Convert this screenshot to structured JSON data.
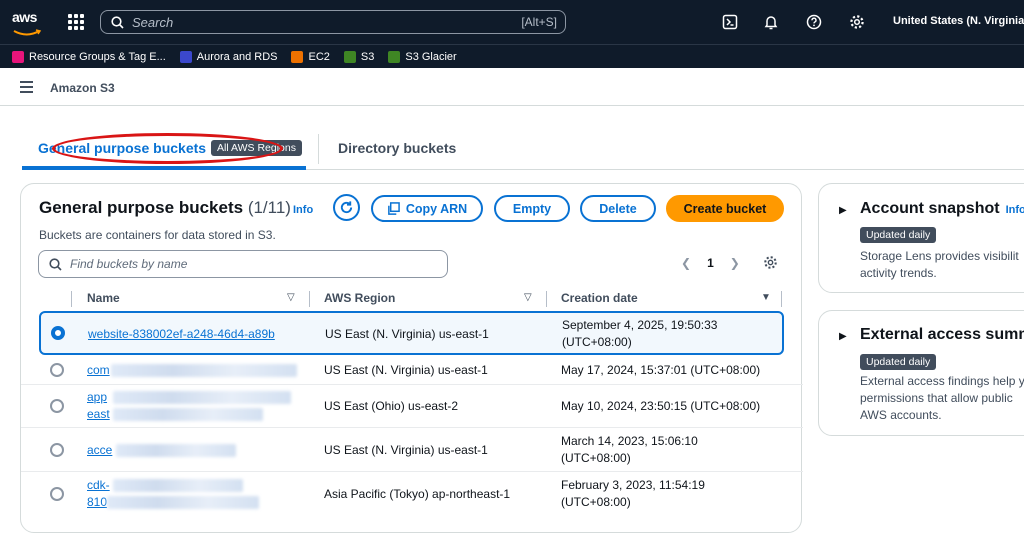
{
  "topbar": {
    "logo_text": "aws",
    "search_placeholder": "Search",
    "search_shortcut": "[Alt+S]",
    "region": "United States (N. Virginia)"
  },
  "favorites": [
    {
      "label": "Resource Groups & Tag E...",
      "color": "#e7157b"
    },
    {
      "label": "Aurora and RDS",
      "color": "#3b48cc"
    },
    {
      "label": "EC2",
      "color": "#ed7100"
    },
    {
      "label": "S3",
      "color": "#3f8624"
    },
    {
      "label": "S3 Glacier",
      "color": "#3f8624"
    }
  ],
  "service": {
    "title": "Amazon S3"
  },
  "tabs": {
    "general": "General purpose buckets",
    "general_badge": "All AWS Regions",
    "directory": "Directory buckets"
  },
  "panel": {
    "title": "General purpose buckets",
    "count": "(1/11)",
    "info": "Info",
    "description": "Buckets are containers for data stored in S3.",
    "copy_arn": "Copy ARN",
    "empty": "Empty",
    "delete": "Delete",
    "create": "Create bucket",
    "find_placeholder": "Find buckets by name",
    "page": "1",
    "col_name": "Name",
    "col_region": "AWS Region",
    "col_date": "Creation date"
  },
  "rows": [
    {
      "name": "website-838002ef-a248-46d4-a89b",
      "name2": "",
      "region": "US East (N. Virginia) us-east-1",
      "date": "September 4, 2025, 19:50:33",
      "date2": "(UTC+08:00)"
    },
    {
      "name": "com",
      "name2": "",
      "region": "US East (N. Virginia) us-east-1",
      "date": "May 17, 2024, 15:37:01 (UTC+08:00)",
      "date2": ""
    },
    {
      "name": "app",
      "name2": "east",
      "region": "US East (Ohio) us-east-2",
      "date": "May 10, 2024, 23:50:15 (UTC+08:00)",
      "date2": ""
    },
    {
      "name": "acce",
      "name2": "",
      "region": "US East (N. Virginia) us-east-1",
      "date": "March 14, 2023, 15:06:10",
      "date2": "(UTC+08:00)"
    },
    {
      "name": "cdk-",
      "name2": "810",
      "region": "Asia Pacific (Tokyo) ap-northeast-1",
      "date": "February 3, 2023, 11:54:19",
      "date2": "(UTC+08:00)"
    }
  ],
  "side": {
    "snapshot_title": "Account snapshot",
    "snapshot_info": "Info",
    "snapshot_badge": "Updated daily",
    "snapshot_line1": "Storage Lens provides visibilit",
    "snapshot_line2": "activity trends.",
    "access_title": "External access summ",
    "access_badge": "Updated daily",
    "access_line1": "External access findings help y",
    "access_line2": "permissions that allow public",
    "access_line3": "AWS accounts."
  }
}
